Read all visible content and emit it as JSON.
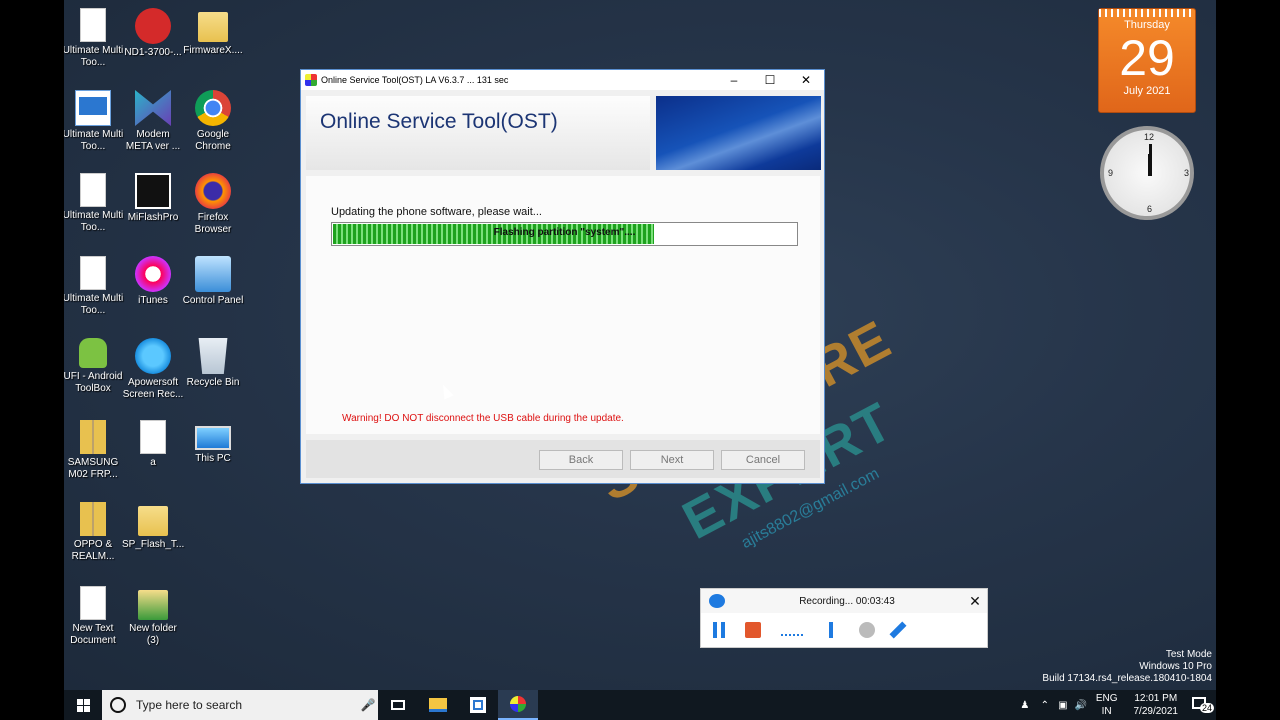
{
  "desktop_icons": [
    {
      "label": "Ultimate Multi Too...",
      "icon": "file-icon"
    },
    {
      "label": "ND1-3700-...",
      "icon": "snapdragon-icon"
    },
    {
      "label": "FirmwareX....",
      "icon": "folder-icon"
    },
    {
      "label": "Ultimate Multi Too...",
      "icon": "app-window-icon"
    },
    {
      "label": "Modem META ver ...",
      "icon": "modem-meta-icon"
    },
    {
      "label": "Google Chrome",
      "icon": "chrome-icon"
    },
    {
      "label": "Ultimate Multi Too...",
      "icon": "file-icon"
    },
    {
      "label": "MiFlashPro",
      "icon": "miflash-icon"
    },
    {
      "label": "Firefox Browser",
      "icon": "firefox-icon"
    },
    {
      "label": "Ultimate Multi Too...",
      "icon": "file-icon"
    },
    {
      "label": "iTunes",
      "icon": "itunes-icon"
    },
    {
      "label": "Control Panel",
      "icon": "control-panel-icon"
    },
    {
      "label": "UFI - Android ToolBox",
      "icon": "android-icon"
    },
    {
      "label": "Apowersoft Screen Rec...",
      "icon": "apowersoft-icon"
    },
    {
      "label": "Recycle Bin",
      "icon": "recycle-bin-icon"
    },
    {
      "label": "SAMSUNG M02 FRP...",
      "icon": "zip-icon"
    },
    {
      "label": "a",
      "icon": "file-icon"
    },
    {
      "label": "This PC",
      "icon": "this-pc-icon"
    },
    {
      "label": "OPPO & REALM...",
      "icon": "zip-icon"
    },
    {
      "label": "SP_Flash_T...",
      "icon": "folder-icon"
    },
    {
      "label": "New Text Document",
      "icon": "file-icon"
    },
    {
      "label": "New folder (3)",
      "icon": "folder-icon"
    }
  ],
  "calendar": {
    "day": "Thursday",
    "date": "29",
    "month": "July 2021"
  },
  "watermark": {
    "line1": "SOFTWARE",
    "line2": "EXPERT",
    "email": "ajits8802@gmail.com"
  },
  "window": {
    "title": "Online Service Tool(OST) LA V6.3.7 ... 131 sec",
    "header_title": "Online Service Tool(OST)",
    "status": "Updating the phone software, please wait...",
    "progress_text": "Flashing partition \"system\"....",
    "progress_fraction": 0.69,
    "warning": "Warning! DO NOT disconnect the USB cable during the update.",
    "buttons": {
      "back": "Back",
      "next": "Next",
      "cancel": "Cancel"
    }
  },
  "recorder": {
    "status": "Recording... 00:03:43"
  },
  "win_info": {
    "mode": "Test Mode",
    "edition": "Windows 10 Pro",
    "build": "Build 17134.rs4_release.180410-1804"
  },
  "taskbar": {
    "search_placeholder": "Type here to search",
    "lang_top": "ENG",
    "lang_bottom": "IN",
    "time": "12:01 PM",
    "date": "7/29/2021",
    "notification_count": "24"
  },
  "colors": {
    "accent": "#1c3574",
    "progress": "#1ea21e",
    "warning": "#dd1111",
    "calendar": "#e0661a"
  }
}
